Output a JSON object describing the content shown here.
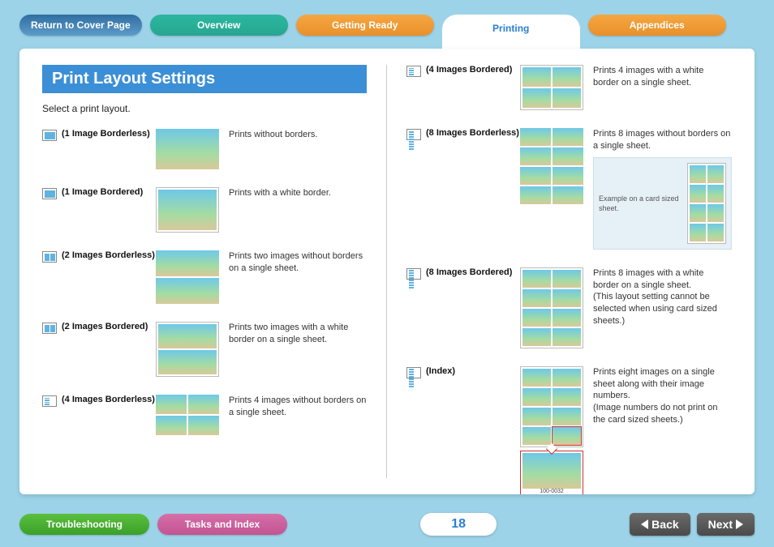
{
  "nav": {
    "cover": "Return to Cover Page",
    "overview": "Overview",
    "getting_ready": "Getting Ready",
    "printing": "Printing",
    "appendices": "Appendices"
  },
  "page": {
    "title": "Print Layout Settings",
    "intro": "Select a print layout.",
    "number": "18"
  },
  "layouts_left": [
    {
      "label": "(1 Image Borderless)",
      "desc": "Prints without borders."
    },
    {
      "label": "(1 Image Bordered)",
      "desc": "Prints with a white border."
    },
    {
      "label": "(2 Images Borderless)",
      "desc": "Prints two images without borders on a single sheet."
    },
    {
      "label": "(2 Images Bordered)",
      "desc": "Prints two images with a white border on a single sheet."
    },
    {
      "label": "(4 Images Borderless)",
      "desc": "Prints 4 images without borders on a single sheet."
    }
  ],
  "layouts_right": [
    {
      "label": "(4 Images Bordered)",
      "desc": "Prints 4 images with a white border on a single sheet."
    },
    {
      "label": "(8 Images Borderless)",
      "desc": "Prints 8 images without borders on a single sheet."
    },
    {
      "label": "(8 Images Bordered)",
      "desc": "Prints 8 images with a white border on a single sheet.\n(This layout setting cannot be selected when using card sized sheets.)"
    },
    {
      "label": "(Index)",
      "desc": "Prints eight images on a single sheet along with their image numbers.\n(Image numbers do not print on the card sized sheets.)"
    }
  ],
  "example_caption": "Example on a card sized sheet.",
  "index_caption": "100-0032",
  "bottom": {
    "trouble": "Troubleshooting",
    "tasks": "Tasks and Index",
    "back": "Back",
    "next": "Next"
  }
}
